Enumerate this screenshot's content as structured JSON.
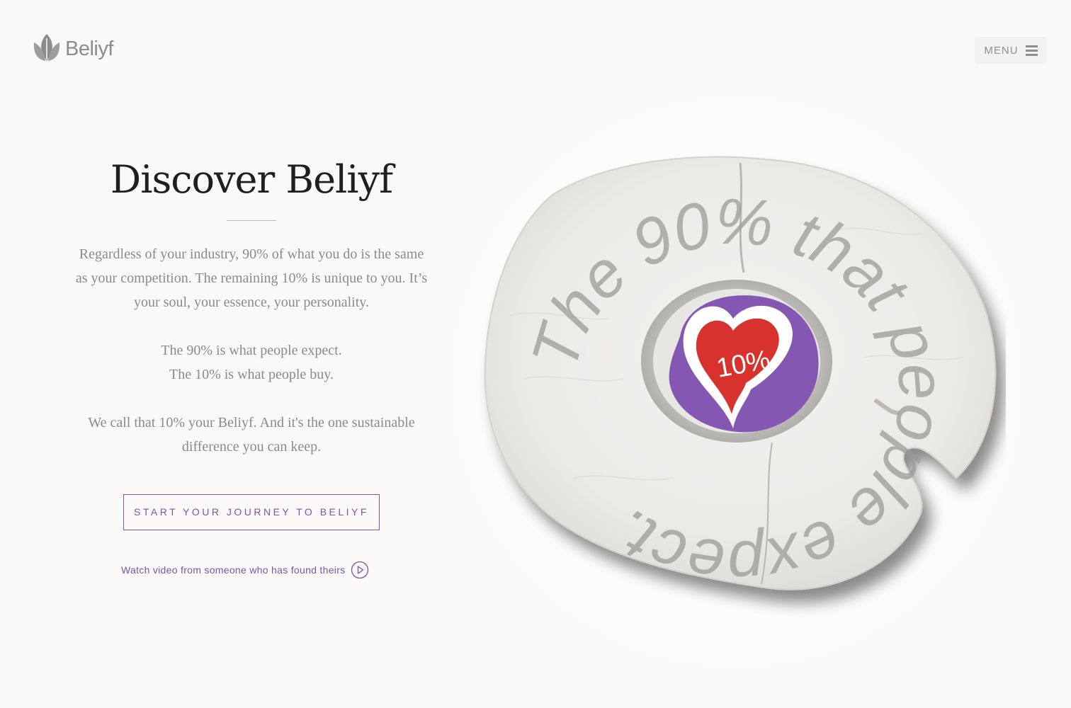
{
  "brand": {
    "name": "Beliyf",
    "logo_color": "#8c8c8c"
  },
  "header": {
    "menu_label": "MENU",
    "menu_icon": "hamburger-icon"
  },
  "hero": {
    "title": "Discover Beliyf",
    "paragraph_1": "Regardless of your industry, 90% of what you do is the same as your competition. The remaining 10% is unique to you. It’s your soul, your essence, your personality.",
    "paragraph_2_line_1": "The 90% is what people expect.",
    "paragraph_2_line_2": "The 10% is what people buy.",
    "paragraph_3": "We call that 10% your Beliyf. And it's the one sustainable difference you can keep.",
    "cta_label": "START YOUR JOURNEY TO BELIYF",
    "video_link_label": "Watch video from someone who has found theirs",
    "video_icon": "play-circle-icon"
  },
  "illustration": {
    "center_label": "10%",
    "ring_text": "The 90% that people expect.",
    "colors": {
      "accent": "#7d55a5",
      "heart": "#d7322e",
      "center_purple": "#8457b3",
      "stump": "#ecebe9"
    }
  }
}
